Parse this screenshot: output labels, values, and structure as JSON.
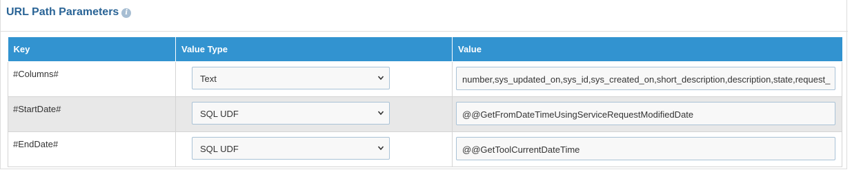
{
  "panel": {
    "title": "URL Path Parameters",
    "info_icon": "info-icon"
  },
  "table": {
    "columns": [
      "Key",
      "Value Type",
      "Value"
    ],
    "rows": [
      {
        "key": "#Columns#",
        "value_type": "Text",
        "value": "number,sys_updated_on,sys_id,sys_created_on,short_description,description,state,request_"
      },
      {
        "key": "#StartDate#",
        "value_type": "SQL UDF",
        "value": "@@GetFromDateTimeUsingServiceRequestModifiedDate"
      },
      {
        "key": "#EndDate#",
        "value_type": "SQL UDF",
        "value": "@@GetToolCurrentDateTime"
      }
    ]
  },
  "colors": {
    "header_bg": "#3293d0",
    "title": "#2a6496",
    "alt_row": "#e8e8e8"
  }
}
